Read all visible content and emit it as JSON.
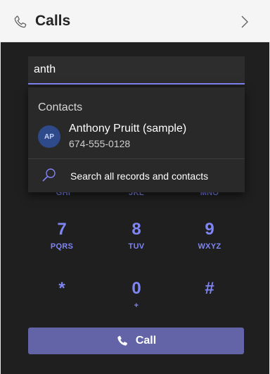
{
  "header": {
    "title": "Calls",
    "phone_icon": "phone-icon",
    "next_icon": "chevron-right-icon"
  },
  "search": {
    "value": "anth"
  },
  "dropdown": {
    "section_label": "Contacts",
    "contact": {
      "initials": "AP",
      "name": "Anthony Pruitt (sample)",
      "number": "674-555-0128"
    },
    "search_all_label": "Search all records and contacts",
    "search_all_icon": "search-icon"
  },
  "dialpad": {
    "row1": [
      {
        "letters": "GHI"
      },
      {
        "letters": "JKL"
      },
      {
        "letters": "MNO"
      }
    ],
    "row2": [
      {
        "digit": "7",
        "letters": "PQRS"
      },
      {
        "digit": "8",
        "letters": "TUV"
      },
      {
        "digit": "9",
        "letters": "WXYZ"
      }
    ],
    "row3": [
      {
        "digit": "*",
        "letters": ""
      },
      {
        "digit": "0",
        "letters": "+"
      },
      {
        "digit": "#",
        "letters": ""
      }
    ]
  },
  "call_button": {
    "label": "Call",
    "icon": "phone-icon"
  },
  "colors": {
    "accent": "#6264a7",
    "accent_light": "#7f85f5",
    "panel_bg": "#1f1f1f",
    "dropdown_bg": "#292929"
  }
}
